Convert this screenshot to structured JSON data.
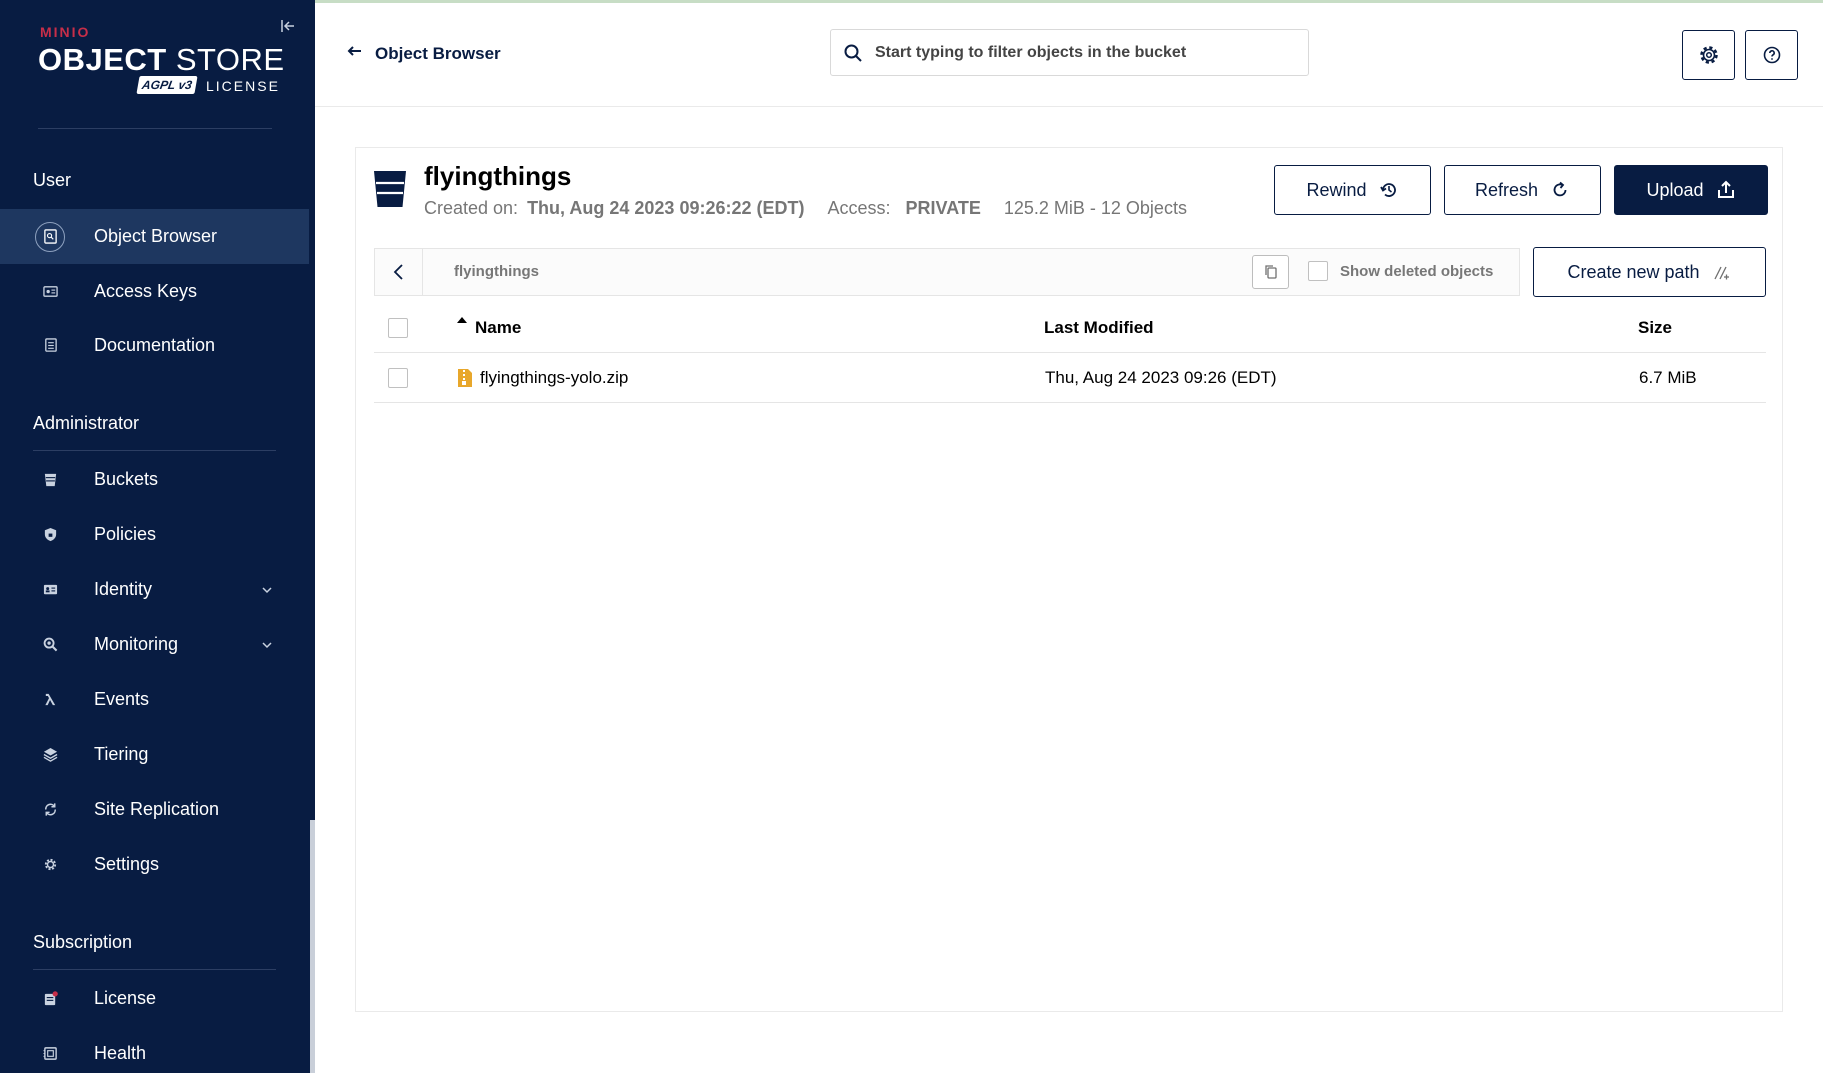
{
  "brand": {
    "minio": "MINIO",
    "store_bold": "OBJECT",
    "store_rest": " STORE",
    "agpl": "AGPL v3",
    "license": "LICENSE"
  },
  "sidebar": {
    "sections": [
      {
        "title": "User",
        "items": [
          {
            "label": "Object Browser",
            "icon": "object-browser-icon",
            "active": true
          },
          {
            "label": "Access Keys",
            "icon": "access-keys-icon"
          },
          {
            "label": "Documentation",
            "icon": "documentation-icon"
          }
        ]
      },
      {
        "title": "Administrator",
        "items": [
          {
            "label": "Buckets",
            "icon": "buckets-icon"
          },
          {
            "label": "Policies",
            "icon": "policies-icon"
          },
          {
            "label": "Identity",
            "icon": "identity-icon",
            "expandable": true
          },
          {
            "label": "Monitoring",
            "icon": "monitoring-icon",
            "expandable": true
          },
          {
            "label": "Events",
            "icon": "lambda-icon"
          },
          {
            "label": "Tiering",
            "icon": "tiering-icon"
          },
          {
            "label": "Site Replication",
            "icon": "site-replication-icon"
          },
          {
            "label": "Settings",
            "icon": "settings-icon"
          }
        ]
      },
      {
        "title": "Subscription",
        "items": [
          {
            "label": "License",
            "icon": "license-icon",
            "badge_color": "#c72e49"
          },
          {
            "label": "Health",
            "icon": "health-icon"
          }
        ]
      }
    ]
  },
  "header": {
    "back_label": "Object Browser",
    "search": {
      "placeholder": "Start typing to filter objects in the bucket",
      "value": ""
    }
  },
  "bucket": {
    "name": "flyingthings",
    "created_label": "Created on:",
    "created_value": "Thu, Aug 24 2023 09:26:22 (EDT)",
    "access_label": "Access:",
    "access_value": "PRIVATE",
    "usage": "125.2 MiB - 12 Objects"
  },
  "actions": {
    "rewind": "Rewind",
    "refresh": "Refresh",
    "upload": "Upload",
    "create_path": "Create new path"
  },
  "path_bar": {
    "path": "flyingthings",
    "show_deleted": "Show deleted objects"
  },
  "table": {
    "columns": [
      "Name",
      "Last Modified",
      "Size"
    ],
    "rows": [
      {
        "name": "flyingthings-yolo.zip",
        "modified": "Thu, Aug 24 2023 09:26 (EDT)",
        "size": "6.7 MiB"
      }
    ]
  },
  "colors": {
    "sidebar_bg": "#081c42",
    "active_item": "#1e3760",
    "primary": "#081c42",
    "file_icon": "#e8a72b",
    "brand_red": "#c72e49"
  }
}
